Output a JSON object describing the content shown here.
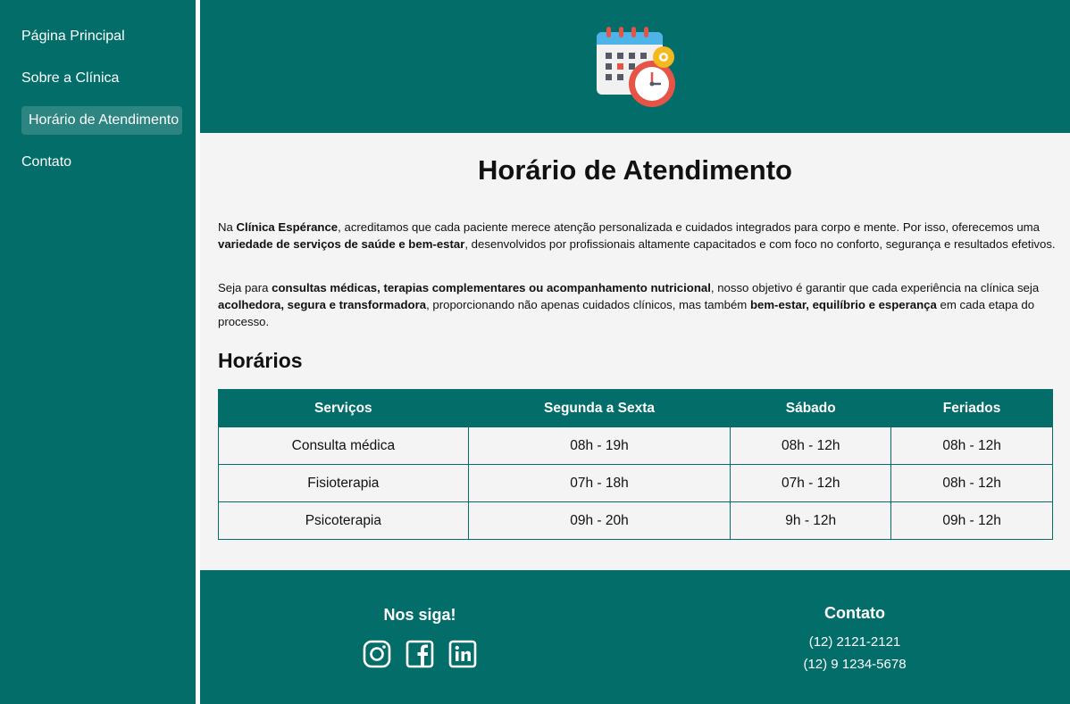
{
  "sidebar": {
    "items": [
      {
        "label": "Página Principal"
      },
      {
        "label": "Sobre a Clínica"
      },
      {
        "label": "Horário de Atendimento",
        "active": true
      },
      {
        "label": "Contato"
      }
    ]
  },
  "header": {
    "icon": "calendar-clock-icon"
  },
  "main": {
    "title": "Horário de Atendimento",
    "para1": {
      "t1": "Na ",
      "b1": "Clínica Espérance",
      "t2": ", acreditamos que cada paciente merece atenção personalizada e cuidados integrados para corpo e mente. Por isso, oferecemos uma ",
      "b2": "variedade de serviços de saúde e bem-estar",
      "t3": ", desenvolvidos por profissionais altamente capacitados e com foco no conforto, segurança e resultados efetivos."
    },
    "para2": {
      "t1": "Seja para ",
      "b1": "consultas médicas, terapias complementares ou acompanhamento nutricional",
      "t2": ", nosso objetivo é garantir que cada experiência na clínica seja ",
      "b2": "acolhedora, segura e transformadora",
      "t3": ", proporcionando não apenas cuidados clínicos, mas também ",
      "b3": "bem-estar, equilíbrio e esperança",
      "t4": " em cada etapa do processo."
    },
    "subtitle": "Horários",
    "table": {
      "headers": [
        "Serviços",
        "Segunda a Sexta",
        "Sábado",
        "Feriados"
      ],
      "rows": [
        [
          "Consulta médica",
          "08h - 19h",
          "08h - 12h",
          "08h - 12h"
        ],
        [
          "Fisioterapia",
          "07h - 18h",
          "07h - 12h",
          "08h - 12h"
        ],
        [
          "Psicoterapia",
          "09h - 20h",
          "9h - 12h",
          "09h - 12h"
        ]
      ]
    }
  },
  "footer": {
    "follow_title": "Nos siga!",
    "social_icons": [
      "instagram-icon",
      "facebook-icon",
      "linkedin-icon"
    ],
    "contact_title": "Contato",
    "phones": [
      "(12) 2121-2121",
      "(12) 9 1234-5678"
    ]
  },
  "colors": {
    "primary": "#036d6a",
    "active_nav": "#2d8581",
    "background": "#f4f4f4",
    "text": "#111111"
  }
}
